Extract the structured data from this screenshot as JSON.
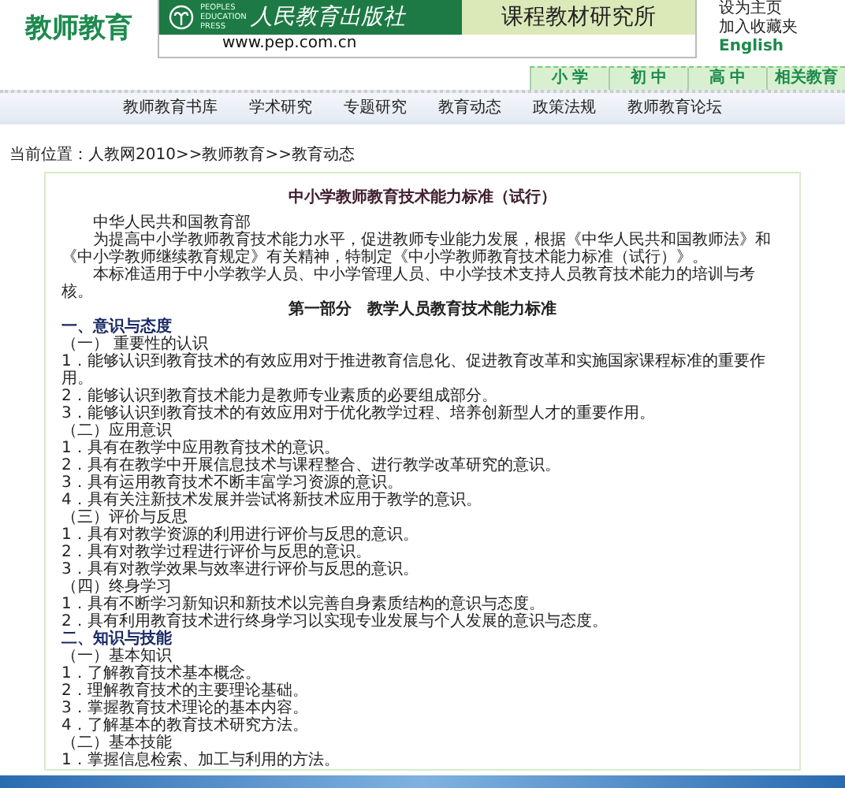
{
  "header": {
    "site_title": "教师教育",
    "publisher": {
      "name_en": "PEOPLES EDUCATION PRESS",
      "name": "人民教育出版社",
      "url": "www.pep.com.cn",
      "institute": "课程教材研究所"
    },
    "links": [
      "设为主页",
      "加入收藏夹",
      "English"
    ]
  },
  "level_tabs": [
    "小 学",
    "初 中",
    "高 中",
    "相关教育"
  ],
  "nav": [
    "教师教育书库",
    "学术研究",
    "专题研究",
    "教育动态",
    "政策法规",
    "教师教育论坛"
  ],
  "breadcrumb": "当前位置：人教网2010>>教师教育>>教育动态",
  "article": {
    "title": "中小学教师教育技术能力标准（试行）",
    "blocks": [
      {
        "kind": "para",
        "text": "中华人民共和国教育部"
      },
      {
        "kind": "para",
        "text": "为提高中小学教师教育技术能力水平，促进教师专业能力发展，根据《中华人民共和国教师法》和《中小学教师继续教育规定》有关精神，特制定《中小学教师教育技术能力标准（试行）》。"
      },
      {
        "kind": "para",
        "text": "本标准适用于中小学教学人员、中小学管理人员、中小学技术支持人员教育技术能力的培训与考核。"
      },
      {
        "kind": "part",
        "text": "第一部分　教学人员教育技术能力标准"
      },
      {
        "kind": "section",
        "text": "一、意识与态度"
      },
      {
        "kind": "sub",
        "text": "（一） 重要性的认识"
      },
      {
        "kind": "item",
        "text": "1．能够认识到教育技术的有效应用对于推进教育信息化、促进教育改革和实施国家课程标准的重要作用。"
      },
      {
        "kind": "item",
        "text": "2．能够认识到教育技术能力是教师专业素质的必要组成部分。"
      },
      {
        "kind": "item",
        "text": "3．能够认识到教育技术的有效应用对于优化教学过程、培养创新型人才的重要作用。"
      },
      {
        "kind": "sub",
        "text": "（二）应用意识"
      },
      {
        "kind": "item",
        "text": "1．具有在教学中应用教育技术的意识。"
      },
      {
        "kind": "item",
        "text": "2．具有在教学中开展信息技术与课程整合、进行教学改革研究的意识。"
      },
      {
        "kind": "item",
        "text": "3．具有运用教育技术不断丰富学习资源的意识。"
      },
      {
        "kind": "item",
        "text": "4．具有关注新技术发展并尝试将新技术应用于教学的意识。"
      },
      {
        "kind": "sub",
        "text": "（三）评价与反思"
      },
      {
        "kind": "item",
        "text": "1．具有对教学资源的利用进行评价与反思的意识。"
      },
      {
        "kind": "item",
        "text": "2．具有对教学过程进行评价与反思的意识。"
      },
      {
        "kind": "item",
        "text": "3．具有对教学效果与效率进行评价与反思的意识。"
      },
      {
        "kind": "sub",
        "text": "（四）终身学习"
      },
      {
        "kind": "item",
        "text": "1．具有不断学习新知识和新技术以完善自身素质结构的意识与态度。"
      },
      {
        "kind": "item",
        "text": "2．具有利用教育技术进行终身学习以实现专业发展与个人发展的意识与态度。"
      },
      {
        "kind": "section",
        "text": "二、知识与技能"
      },
      {
        "kind": "sub",
        "text": "（一）基本知识"
      },
      {
        "kind": "item",
        "text": "1．了解教育技术基本概念。"
      },
      {
        "kind": "item",
        "text": "2．理解教育技术的主要理论基础。"
      },
      {
        "kind": "item",
        "text": "3．掌握教育技术理论的基本内容。"
      },
      {
        "kind": "item",
        "text": "4．了解基本的教育技术研究方法。"
      },
      {
        "kind": "sub",
        "text": "（二）基本技能"
      },
      {
        "kind": "item",
        "text": "1．掌握信息检索、加工与利用的方法。"
      }
    ]
  }
}
